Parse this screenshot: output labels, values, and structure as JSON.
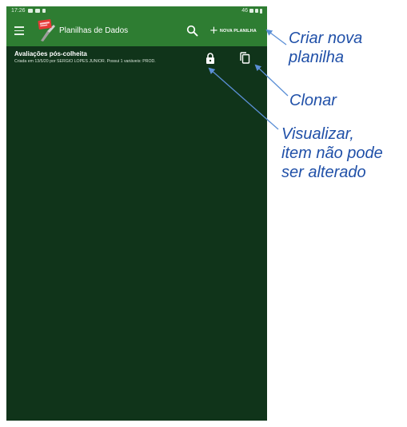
{
  "status_bar": {
    "time": "17:26",
    "right_text": "46"
  },
  "toolbar": {
    "title": "Planilhas de Dados",
    "new_sheet_label": "NOVA PLANILHA",
    "menu_icon": "menu-icon",
    "search_icon": "search-icon",
    "add_icon": "plus-icon"
  },
  "list": {
    "items": [
      {
        "title": "Avaliações pós-colheita",
        "subtitle": "Criada em 13/5/20 por SERGIO LOPES JUNIOR. Possui 1 variáveis: PROD.",
        "lock_icon": "lock-icon",
        "copy_icon": "copy-icon"
      }
    ]
  },
  "annotations": {
    "create": [
      "Criar nova",
      "planilha"
    ],
    "clone": "Clonar",
    "view": [
      "Visualizar,",
      "item não pode",
      "ser alterado"
    ]
  },
  "colors": {
    "toolbar": "#2e7d32",
    "background": "#10341a",
    "annotation": "#2050a8"
  }
}
